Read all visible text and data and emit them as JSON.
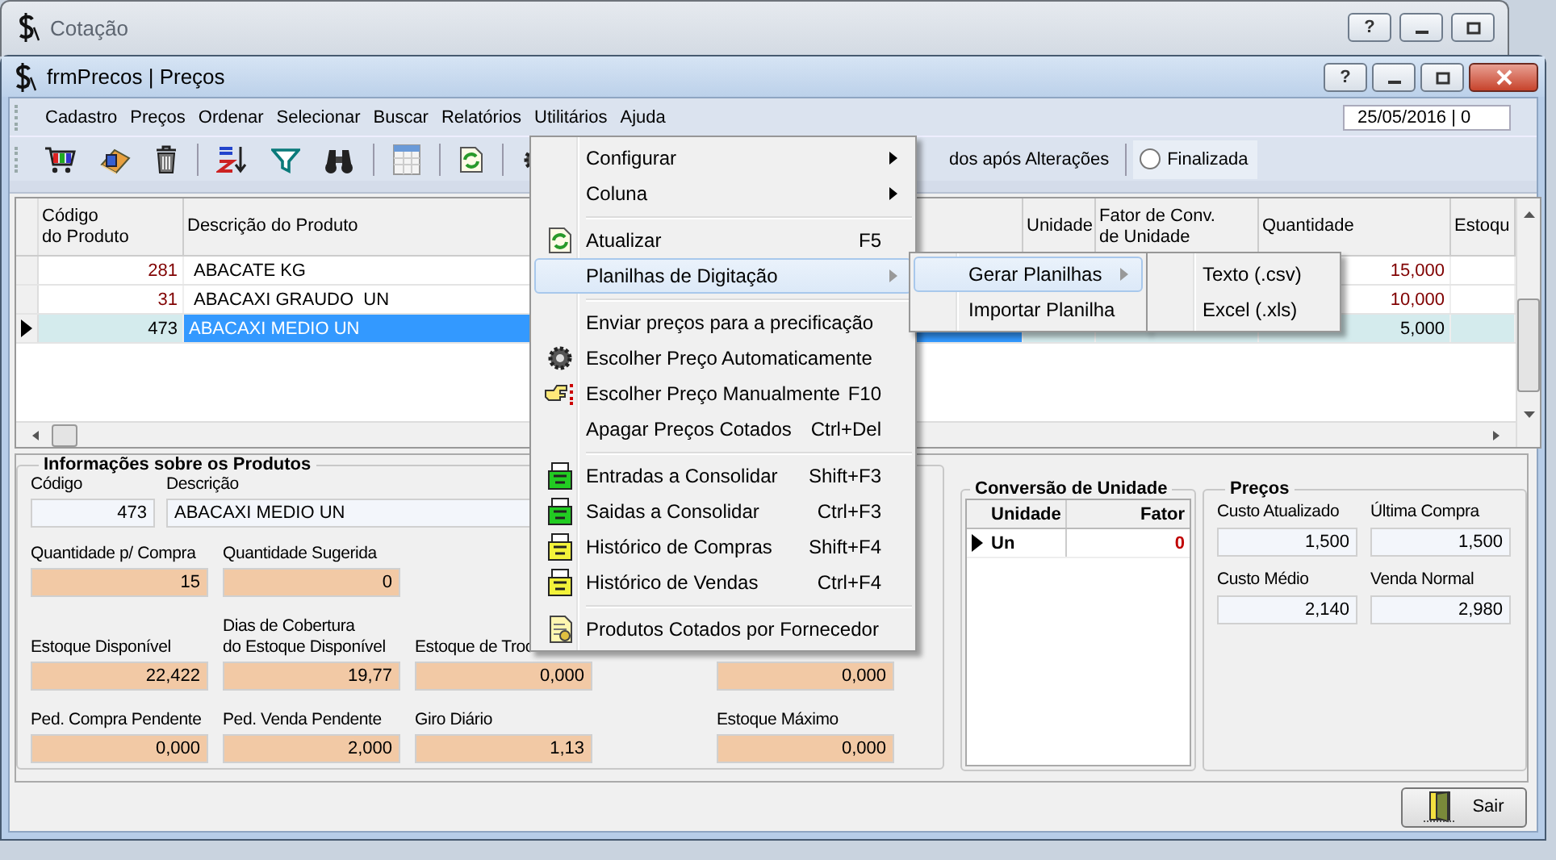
{
  "outer_window": {
    "title": "Cotação",
    "help_button": "?"
  },
  "window": {
    "title": "frmPrecos | Preços",
    "help_button": "?"
  },
  "menu_bar": [
    "Cadastro",
    "Preços",
    "Ordenar",
    "Selecionar",
    "Buscar",
    "Relatórios",
    "Utilitários",
    "Ajuda"
  ],
  "date": "25/05/2016 | 0",
  "toolbar": {
    "option_text": "dos após Alterações",
    "radio": {
      "label": "Finalizada",
      "checked": false
    }
  },
  "grid": {
    "columns": [
      "Código\ndo Produto",
      "Descrição do Produto",
      "Unidade",
      "Fator de Conv.\nde Unidade",
      "Quantidade",
      "Estoqu"
    ],
    "rows": [
      {
        "codigo": "281",
        "descricao": "ABACATE KG",
        "quantidade": "15,000",
        "selected": false
      },
      {
        "codigo": "31",
        "descricao": "ABACAXI GRAUDO  UN",
        "quantidade": "10,000",
        "selected": false
      },
      {
        "codigo": "473",
        "descricao": "ABACAXI MEDIO UN",
        "quantidade": "5,000",
        "selected": true
      }
    ]
  },
  "menu": [
    {
      "kind": "item",
      "label": "Configurar",
      "submenu": true,
      "selected": false
    },
    {
      "kind": "item",
      "label": "Coluna",
      "submenu": true,
      "selected": false
    },
    {
      "kind": "separator"
    },
    {
      "kind": "item",
      "label": "Atualizar",
      "shortcut": "F5",
      "submenu": false,
      "selected": false
    },
    {
      "kind": "item",
      "label": "Planilhas de Digitação",
      "submenu": true,
      "selected": true
    },
    {
      "kind": "separator"
    },
    {
      "kind": "item",
      "label": "Enviar preços para a precificação",
      "submenu": false,
      "selected": false
    },
    {
      "kind": "item",
      "label": "Escolher Preço Automaticamente",
      "submenu": false,
      "selected": false
    },
    {
      "kind": "item",
      "label": "Escolher Preço Manualmente",
      "shortcut": "F10",
      "submenu": false,
      "selected": false
    },
    {
      "kind": "item",
      "label": "Apagar Preços Cotados",
      "shortcut": "Ctrl+Del",
      "submenu": false,
      "selected": false
    },
    {
      "kind": "separator"
    },
    {
      "kind": "item",
      "label": "Entradas a Consolidar",
      "shortcut": "Shift+F3",
      "submenu": false,
      "selected": false
    },
    {
      "kind": "item",
      "label": "Saidas a Consolidar",
      "shortcut": "Ctrl+F3",
      "submenu": false,
      "selected": false
    },
    {
      "kind": "item",
      "label": "Histórico de Compras",
      "shortcut": "Shift+F4",
      "submenu": false,
      "selected": false
    },
    {
      "kind": "item",
      "label": "Histórico de Vendas",
      "shortcut": "Ctrl+F4",
      "submenu": false,
      "selected": false
    },
    {
      "kind": "separator"
    },
    {
      "kind": "item",
      "label": "Produtos Cotados por Fornecedor",
      "submenu": false,
      "selected": false
    }
  ],
  "submenu": [
    {
      "label": "Gerar Planilhas",
      "submenu": true,
      "selected": true
    },
    {
      "label": "Importar Planilha",
      "submenu": false,
      "selected": false
    }
  ],
  "submenu_2": [
    {
      "label": "Texto (.csv)",
      "selected": false
    },
    {
      "label": "Excel (.xls)",
      "selected": false
    }
  ],
  "info": {
    "title": "Informações sobre os Produtos",
    "codigo": {
      "label": "Código",
      "value": "473"
    },
    "descricao": {
      "label": "Descrição",
      "value": "ABACAXI MEDIO UN"
    },
    "rows": [
      [
        {
          "label": "Quantidade p/ Compra",
          "value": "15"
        },
        {
          "label": "Quantidade Sugerida",
          "value": "0"
        }
      ],
      [
        {
          "label": "Estoque Disponível",
          "value": "22,422"
        },
        {
          "label": "Dias de Cobertura\ndo Estoque Disponível",
          "value": "19,77"
        },
        {
          "label": "Estoque de Troc",
          "value": "0,000"
        },
        {
          "value": "0,000"
        }
      ],
      [
        {
          "label": "Ped. Compra Pendente",
          "value": "0,000"
        },
        {
          "label": "Ped. Venda Pendente",
          "value": "2,000"
        },
        {
          "label": "Giro Diário",
          "value": "1,13"
        },
        {
          "label": "Estoque Máximo",
          "value": "0,000"
        }
      ]
    ]
  },
  "conversion": {
    "title": "Conversão de Unidade",
    "columns": [
      "Unidade",
      "Fator"
    ],
    "rows": [
      {
        "unidade": "Un",
        "fator": "0",
        "selected": true
      }
    ]
  },
  "prices": {
    "title": "Preços",
    "fields": [
      {
        "label": "Custo Atualizado",
        "value": "1,500"
      },
      {
        "label": "Última Compra",
        "value": "1,500"
      },
      {
        "label": "Custo Médio",
        "value": "2,140"
      },
      {
        "label": "Venda Normal",
        "value": "2,980"
      }
    ]
  },
  "exit_button": "Sair"
}
